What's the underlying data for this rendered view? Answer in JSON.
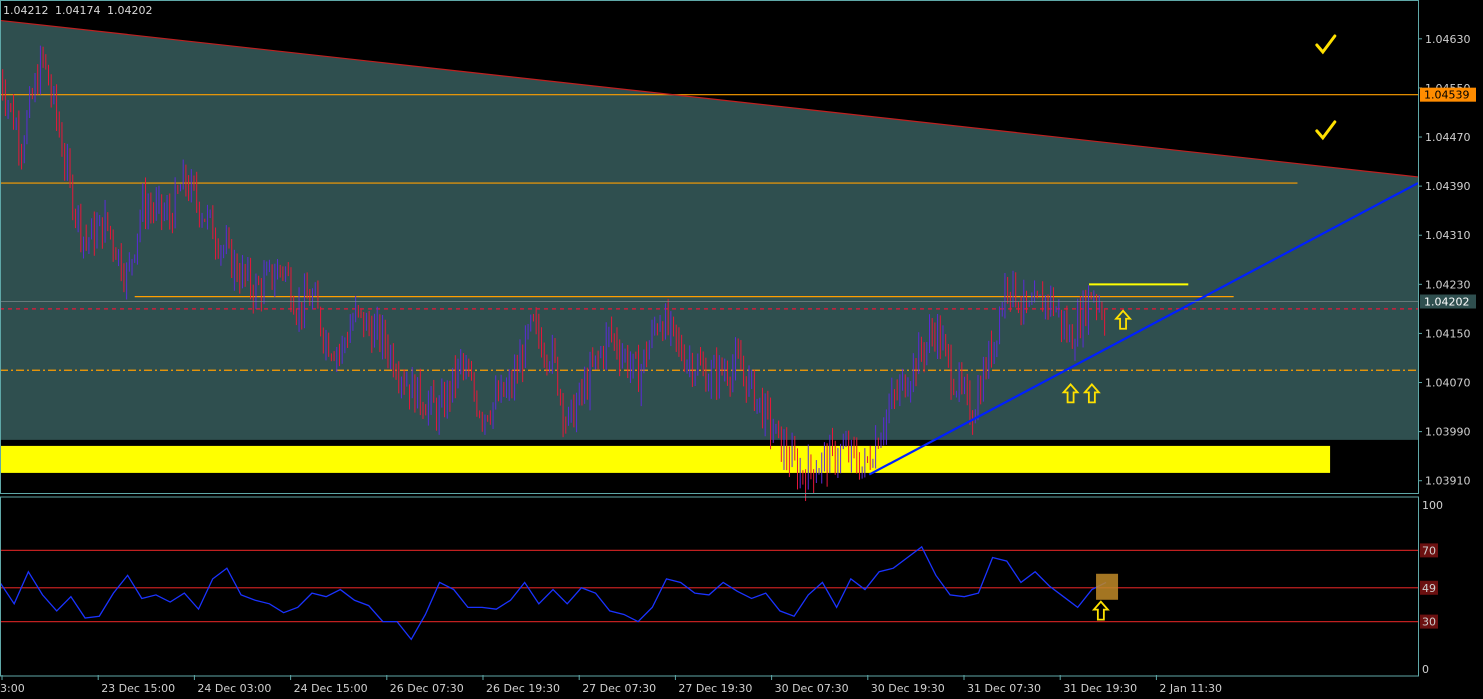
{
  "header": {
    "open": "1.04212",
    "high": "1.04174",
    "low": "1.04202"
  },
  "colors": {
    "background": "#000000",
    "frame": "#5fa8a8",
    "zone_fill": "#2f4f4f",
    "bull": "#5b2bd9",
    "bear": "#e8173a",
    "orange_line": "#ff9f00",
    "yellow_zone": "#ffff00",
    "blue_trend": "#0020ff",
    "red_trend": "#c02020",
    "price_tag": "#ff8c00",
    "current_tag": "#2f4f4f",
    "rsi_line": "#1a33ff",
    "rsi_level": "#c02020",
    "highlight_box": "#c08a28"
  },
  "chart_data": [
    {
      "type": "candlestick",
      "symbol_quote": [
        "1.04212",
        "1.04174",
        "1.04202"
      ],
      "ylim": [
        1.0389,
        1.0469
      ],
      "y_ticks": [
        "1.04630",
        "1.04550",
        "1.04470",
        "1.04390",
        "1.04310",
        "1.04230",
        "1.04150",
        "1.04070",
        "1.03990",
        "1.03910"
      ],
      "x_ticks": [
        "3:00",
        "23 Dec 15:00",
        "24 Dec 03:00",
        "24 Dec 15:00",
        "26 Dec 07:30",
        "26 Dec 19:30",
        "27 Dec 07:30",
        "27 Dec 19:30",
        "30 Dec 07:30",
        "30 Dec 19:30",
        "31 Dec 07:30",
        "31 Dec 19:30",
        "2 Jan 11:30"
      ],
      "x_range": [
        0,
        100
      ],
      "close_path": [
        [
          0,
          1.0457
        ],
        [
          1.5,
          1.0446
        ],
        [
          3,
          1.046
        ],
        [
          4,
          1.045
        ],
        [
          5,
          1.0438
        ],
        [
          6,
          1.043
        ],
        [
          7.5,
          1.0433
        ],
        [
          9,
          1.0424
        ],
        [
          10,
          1.0436
        ],
        [
          12,
          1.0434
        ],
        [
          13,
          1.044
        ],
        [
          15,
          1.0432
        ],
        [
          16.5,
          1.0426
        ],
        [
          18,
          1.0422
        ],
        [
          20,
          1.0426
        ],
        [
          21,
          1.0419
        ],
        [
          22,
          1.0421
        ],
        [
          23,
          1.0414
        ],
        [
          24,
          1.0412
        ],
        [
          25,
          1.0418
        ],
        [
          27,
          1.0414
        ],
        [
          28,
          1.041
        ],
        [
          29,
          1.0406
        ],
        [
          31,
          1.0402
        ],
        [
          32.5,
          1.041
        ],
        [
          34,
          1.0402
        ],
        [
          36,
          1.0406
        ],
        [
          37.5,
          1.0416
        ],
        [
          39,
          1.0411
        ],
        [
          40,
          1.04
        ],
        [
          42,
          1.041
        ],
        [
          43,
          1.0415
        ],
        [
          45,
          1.0408
        ],
        [
          46.5,
          1.0418
        ],
        [
          48,
          1.0412
        ],
        [
          50,
          1.0408
        ],
        [
          52,
          1.041
        ],
        [
          53,
          1.0406
        ],
        [
          55,
          1.0397
        ],
        [
          56.5,
          1.0392
        ],
        [
          58,
          1.0394
        ],
        [
          59.5,
          1.0396
        ],
        [
          61,
          1.0393
        ],
        [
          62.5,
          1.0402
        ],
        [
          64,
          1.0408
        ],
        [
          66,
          1.0416
        ],
        [
          67,
          1.0409
        ],
        [
          68.5,
          1.0402
        ],
        [
          70,
          1.0413
        ],
        [
          71,
          1.0424
        ],
        [
          72.5,
          1.0418
        ],
        [
          74,
          1.0421
        ],
        [
          75.5,
          1.0414
        ],
        [
          77,
          1.0422
        ],
        [
          78,
          1.0418
        ]
      ],
      "last_price": 1.04202,
      "horizontal_levels": [
        {
          "price": 1.04539,
          "style": "solid",
          "color": "orange",
          "label": "1.04539"
        },
        {
          "price": 1.04395,
          "style": "solid",
          "color": "orange",
          "label": ""
        },
        {
          "price": 1.0421,
          "style": "solid",
          "color": "orange",
          "label": ""
        },
        {
          "price": 1.0419,
          "style": "dashed",
          "color": "red",
          "label": ""
        },
        {
          "price": 1.0409,
          "style": "dash-dot",
          "color": "orange",
          "label": ""
        },
        {
          "price": 1.0423,
          "style": "solid-short",
          "color": "yellow",
          "label": ""
        }
      ],
      "support_zone": [
        1.03945,
        1.0397
      ],
      "trendlines": [
        {
          "name": "",
          "from": [
            0,
            1.0466
          ],
          "to": [
            100,
            1.04405
          ],
          "color": "red"
        },
        {
          "name": "",
          "from": [
            61.3,
            1.0392
          ],
          "to": [
            100,
            1.04395
          ],
          "color": "blue"
        }
      ],
      "annotations": [
        {
          "kind": "check-mark",
          "x": 93.5,
          "price": 1.0462
        },
        {
          "kind": "check-mark",
          "x": 93.5,
          "price": 1.0448
        },
        {
          "kind": "up-arrow",
          "x": 75.5,
          "price": 1.0408
        },
        {
          "kind": "up-arrow",
          "x": 77,
          "price": 1.0408
        },
        {
          "kind": "up-arrow",
          "x": 79.2,
          "price": 1.042
        }
      ]
    },
    {
      "type": "line",
      "indicator": "oscillator",
      "ylim": [
        0,
        100
      ],
      "y_ticks": [
        "100",
        "70",
        "49",
        "30",
        "0"
      ],
      "levels": [
        70,
        49,
        30
      ],
      "series": [
        {
          "name": "",
          "points": [
            [
              0,
              52
            ],
            [
              1,
              40
            ],
            [
              2,
              58
            ],
            [
              3,
              45
            ],
            [
              4,
              36
            ],
            [
              5,
              44
            ],
            [
              6,
              32
            ],
            [
              7,
              33
            ],
            [
              8,
              46
            ],
            [
              9,
              56
            ],
            [
              10,
              43
            ],
            [
              11,
              45
            ],
            [
              12,
              41
            ],
            [
              13,
              46
            ],
            [
              14,
              37
            ],
            [
              15,
              54
            ],
            [
              16,
              60
            ],
            [
              17,
              45
            ],
            [
              18,
              42
            ],
            [
              19,
              40
            ],
            [
              20,
              35
            ],
            [
              21,
              38
            ],
            [
              22,
              46
            ],
            [
              23,
              44
            ],
            [
              24,
              48
            ],
            [
              25,
              42
            ],
            [
              26,
              39
            ],
            [
              27,
              30
            ],
            [
              28,
              30
            ],
            [
              29,
              20
            ],
            [
              30,
              34
            ],
            [
              31,
              52
            ],
            [
              32,
              48
            ],
            [
              33,
              38
            ],
            [
              34,
              38
            ],
            [
              35,
              37
            ],
            [
              36,
              42
            ],
            [
              37,
              52
            ],
            [
              38,
              40
            ],
            [
              39,
              48
            ],
            [
              40,
              40
            ],
            [
              41,
              49
            ],
            [
              42,
              46
            ],
            [
              43,
              36
            ],
            [
              44,
              34
            ],
            [
              45,
              30
            ],
            [
              46,
              38
            ],
            [
              47,
              54
            ],
            [
              48,
              52
            ],
            [
              49,
              46
            ],
            [
              50,
              45
            ],
            [
              51,
              52
            ],
            [
              52,
              47
            ],
            [
              53,
              43
            ],
            [
              54,
              46
            ],
            [
              55,
              36
            ],
            [
              56,
              33
            ],
            [
              57,
              45
            ],
            [
              58,
              52
            ],
            [
              59,
              38
            ],
            [
              60,
              54
            ],
            [
              61,
              48
            ],
            [
              62,
              58
            ],
            [
              63,
              60
            ],
            [
              64,
              66
            ],
            [
              65,
              72
            ],
            [
              66,
              56
            ],
            [
              67,
              45
            ],
            [
              68,
              44
            ],
            [
              69,
              46
            ],
            [
              70,
              66
            ],
            [
              71,
              64
            ],
            [
              72,
              52
            ],
            [
              73,
              58
            ],
            [
              74,
              50
            ],
            [
              75,
              44
            ],
            [
              76,
              38
            ],
            [
              77,
              48
            ],
            [
              78,
              52
            ]
          ]
        }
      ],
      "highlight_box_value": 49,
      "annotations": [
        {
          "kind": "up-arrow",
          "x": 77,
          "value": 30
        }
      ]
    }
  ]
}
